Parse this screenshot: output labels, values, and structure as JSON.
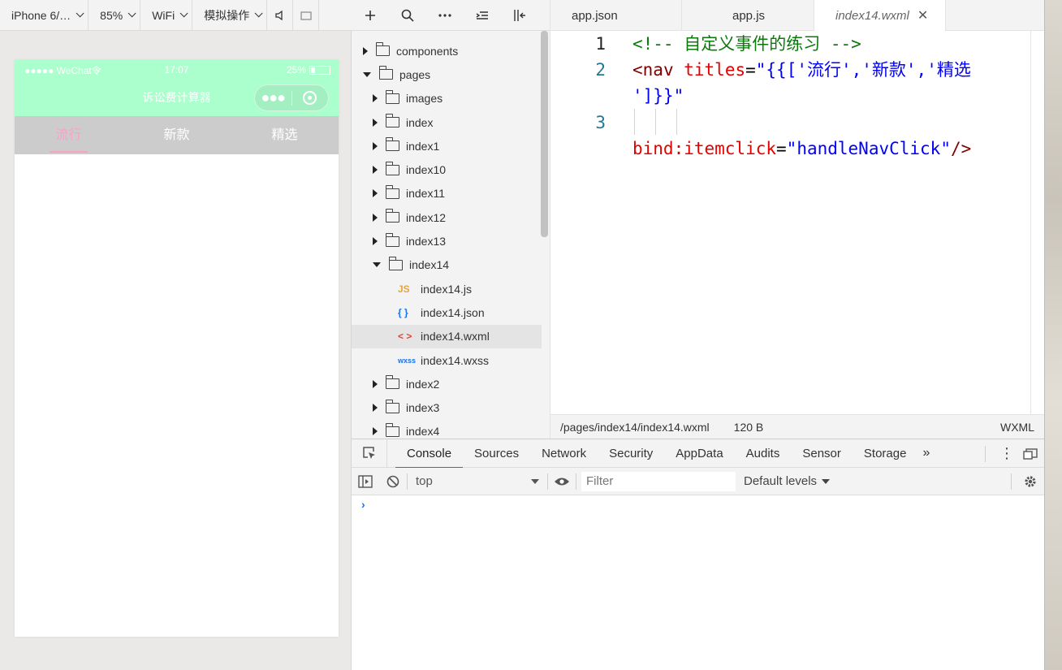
{
  "simulator": {
    "toolbar": {
      "device": "iPhone 6/…",
      "zoom": "85%",
      "network": "WiFi",
      "operation": "模拟操作"
    },
    "status_bar": {
      "carrier": "●●●●● WeChat令",
      "time": "17:07",
      "battery": "25%"
    },
    "nav_title": "诉讼费计算器",
    "capsule_more": "●●●",
    "tabs": [
      "流行",
      "新款",
      "精选"
    ],
    "active_tab_color": "#ff9fc6",
    "nav_bg_color": "#aaffcc"
  },
  "explorer": {
    "toolbar_icons": [
      "plus-icon",
      "search-icon",
      "more-icon",
      "collapse-icon",
      "split-icon"
    ],
    "tree": [
      {
        "label": "components",
        "type": "folder",
        "state": "collapsed",
        "depth": 0
      },
      {
        "label": "pages",
        "type": "folder",
        "state": "expanded",
        "depth": 0
      },
      {
        "label": "images",
        "type": "folder",
        "state": "collapsed",
        "depth": 1
      },
      {
        "label": "index",
        "type": "folder",
        "state": "collapsed",
        "depth": 1
      },
      {
        "label": "index1",
        "type": "folder",
        "state": "collapsed",
        "depth": 1
      },
      {
        "label": "index10",
        "type": "folder",
        "state": "collapsed",
        "depth": 1
      },
      {
        "label": "index11",
        "type": "folder",
        "state": "collapsed",
        "depth": 1
      },
      {
        "label": "index12",
        "type": "folder",
        "state": "collapsed",
        "depth": 1
      },
      {
        "label": "index13",
        "type": "folder",
        "state": "collapsed",
        "depth": 1
      },
      {
        "label": "index14",
        "type": "folder",
        "state": "expanded",
        "depth": 1
      },
      {
        "label": "index14.js",
        "type": "js",
        "icon_text": "JS",
        "depth": 2
      },
      {
        "label": "index14.json",
        "type": "json",
        "icon_text": "{ }",
        "depth": 2
      },
      {
        "label": "index14.wxml",
        "type": "wxml",
        "icon_text": "< >",
        "depth": 2,
        "selected": true
      },
      {
        "label": "index14.wxss",
        "type": "wxss",
        "icon_text": "wxss",
        "depth": 2
      },
      {
        "label": "index2",
        "type": "folder",
        "state": "collapsed",
        "depth": 1
      },
      {
        "label": "index3",
        "type": "folder",
        "state": "collapsed",
        "depth": 1
      },
      {
        "label": "index4",
        "type": "folder",
        "state": "collapsed",
        "depth": 1
      }
    ]
  },
  "editor": {
    "tabs": [
      {
        "label": "app.json",
        "active": false
      },
      {
        "label": "app.js",
        "active": false
      },
      {
        "label": "index14.wxml",
        "active": true,
        "close": "✕"
      }
    ],
    "line_numbers": [
      "1",
      "2",
      "3"
    ],
    "code": {
      "l1_comment": "<!-- 自定义事件的练习 -->",
      "l2_open": "<",
      "l2_tag": "nav",
      "l2_attr": "titles",
      "l2_eq": "=",
      "l2_val_a": "\"{{['流行','新款','精选",
      "l2_val_b": "']}}\"",
      "l3_attr": "bind:itemclick",
      "l3_eq": "=",
      "l3_val": "\"handleNavClick\"",
      "l3_close": "/>"
    },
    "status": {
      "path": "/pages/index14/index14.wxml",
      "size": "120 B",
      "language": "WXML"
    }
  },
  "devtools": {
    "tabs": [
      "Console",
      "Sources",
      "Network",
      "Security",
      "AppData",
      "Audits",
      "Sensor",
      "Storage"
    ],
    "active_tab": "Console",
    "more": "»",
    "context": "top",
    "filter_placeholder": "Filter",
    "levels": "Default levels",
    "prompt": "›"
  }
}
